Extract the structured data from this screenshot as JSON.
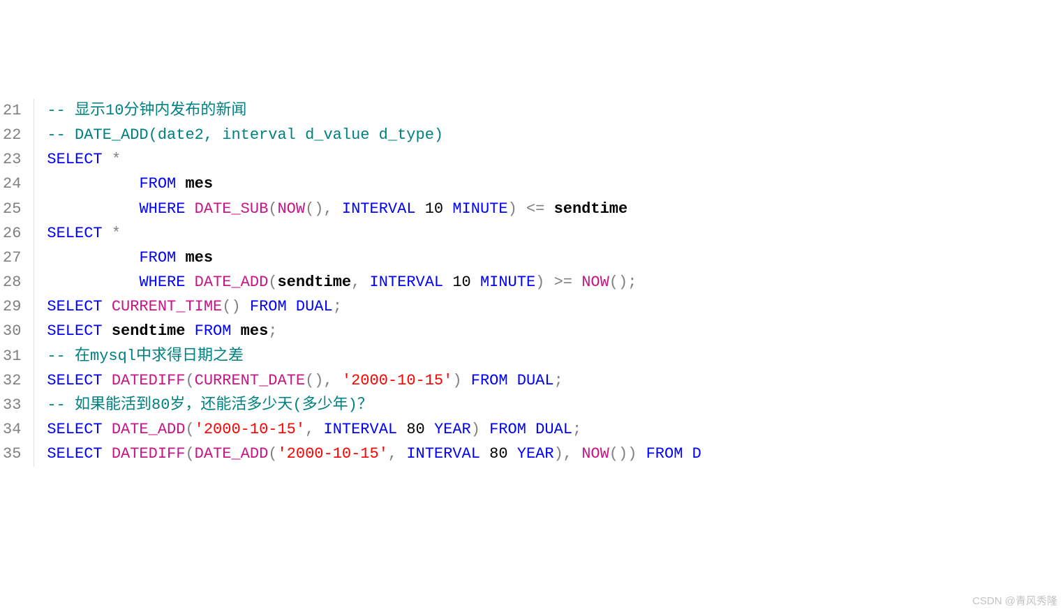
{
  "watermark": "CSDN @青风秀隆",
  "lines": [
    {
      "num": "21",
      "tokens": [
        {
          "cls": "kw-teal",
          "t": "-- 显示10分钟内发布的新闻"
        }
      ]
    },
    {
      "num": "22",
      "tokens": [
        {
          "cls": "kw-teal",
          "t": "-- DATE_ADD(date2, interval d_value d_type)"
        }
      ]
    },
    {
      "num": "23",
      "tokens": [
        {
          "cls": "kw-blue",
          "t": "SELECT"
        },
        {
          "cls": "kw-black-nb",
          "t": " "
        },
        {
          "cls": "star",
          "t": "*"
        }
      ]
    },
    {
      "num": "24",
      "tokens": [
        {
          "cls": "kw-black-nb",
          "t": "          "
        },
        {
          "cls": "kw-blue",
          "t": "FROM"
        },
        {
          "cls": "kw-black-nb",
          "t": " "
        },
        {
          "cls": "kw-black",
          "t": "mes"
        }
      ]
    },
    {
      "num": "25",
      "tokens": [
        {
          "cls": "kw-black-nb",
          "t": "          "
        },
        {
          "cls": "kw-blue",
          "t": "WHERE"
        },
        {
          "cls": "kw-black-nb",
          "t": " "
        },
        {
          "cls": "kw-magenta",
          "t": "DATE_SUB"
        },
        {
          "cls": "op",
          "t": "("
        },
        {
          "cls": "kw-magenta",
          "t": "NOW"
        },
        {
          "cls": "op",
          "t": "(), "
        },
        {
          "cls": "kw-blue",
          "t": "INTERVAL"
        },
        {
          "cls": "kw-black-nb",
          "t": " "
        },
        {
          "cls": "num",
          "t": "10"
        },
        {
          "cls": "kw-black-nb",
          "t": " "
        },
        {
          "cls": "kw-blue",
          "t": "MINUTE"
        },
        {
          "cls": "op",
          "t": ") "
        },
        {
          "cls": "op",
          "t": "<="
        },
        {
          "cls": "kw-black-nb",
          "t": " "
        },
        {
          "cls": "kw-black",
          "t": "sendtime"
        }
      ]
    },
    {
      "num": "26",
      "tokens": [
        {
          "cls": "kw-blue",
          "t": "SELECT"
        },
        {
          "cls": "kw-black-nb",
          "t": " "
        },
        {
          "cls": "star",
          "t": "*"
        }
      ]
    },
    {
      "num": "27",
      "tokens": [
        {
          "cls": "kw-black-nb",
          "t": "          "
        },
        {
          "cls": "kw-blue",
          "t": "FROM"
        },
        {
          "cls": "kw-black-nb",
          "t": " "
        },
        {
          "cls": "kw-black",
          "t": "mes"
        }
      ]
    },
    {
      "num": "28",
      "tokens": [
        {
          "cls": "kw-black-nb",
          "t": "          "
        },
        {
          "cls": "kw-blue",
          "t": "WHERE"
        },
        {
          "cls": "kw-black-nb",
          "t": " "
        },
        {
          "cls": "kw-magenta",
          "t": "DATE_ADD"
        },
        {
          "cls": "op",
          "t": "("
        },
        {
          "cls": "kw-black",
          "t": "sendtime"
        },
        {
          "cls": "op",
          "t": ", "
        },
        {
          "cls": "kw-blue",
          "t": "INTERVAL"
        },
        {
          "cls": "kw-black-nb",
          "t": " "
        },
        {
          "cls": "num",
          "t": "10"
        },
        {
          "cls": "kw-black-nb",
          "t": " "
        },
        {
          "cls": "kw-blue",
          "t": "MINUTE"
        },
        {
          "cls": "op",
          "t": ") "
        },
        {
          "cls": "op",
          "t": ">="
        },
        {
          "cls": "kw-black-nb",
          "t": " "
        },
        {
          "cls": "kw-magenta",
          "t": "NOW"
        },
        {
          "cls": "op",
          "t": "();"
        }
      ]
    },
    {
      "num": "29",
      "tokens": [
        {
          "cls": "kw-blue",
          "t": "SELECT"
        },
        {
          "cls": "kw-black-nb",
          "t": " "
        },
        {
          "cls": "kw-magenta",
          "t": "CURRENT_TIME"
        },
        {
          "cls": "op",
          "t": "() "
        },
        {
          "cls": "kw-blue",
          "t": "FROM"
        },
        {
          "cls": "kw-black-nb",
          "t": " "
        },
        {
          "cls": "kw-blue",
          "t": "DUAL"
        },
        {
          "cls": "op",
          "t": ";"
        }
      ]
    },
    {
      "num": "30",
      "tokens": [
        {
          "cls": "kw-blue",
          "t": "SELECT"
        },
        {
          "cls": "kw-black-nb",
          "t": " "
        },
        {
          "cls": "kw-black",
          "t": "sendtime"
        },
        {
          "cls": "kw-black-nb",
          "t": " "
        },
        {
          "cls": "kw-blue",
          "t": "FROM"
        },
        {
          "cls": "kw-black-nb",
          "t": " "
        },
        {
          "cls": "kw-black",
          "t": "mes"
        },
        {
          "cls": "op",
          "t": ";"
        }
      ]
    },
    {
      "num": "31",
      "tokens": [
        {
          "cls": "kw-teal",
          "t": "-- 在mysql中求得日期之差"
        }
      ]
    },
    {
      "num": "32",
      "tokens": [
        {
          "cls": "kw-blue",
          "t": "SELECT"
        },
        {
          "cls": "kw-black-nb",
          "t": " "
        },
        {
          "cls": "kw-magenta",
          "t": "DATEDIFF"
        },
        {
          "cls": "op",
          "t": "("
        },
        {
          "cls": "kw-magenta",
          "t": "CURRENT_DATE"
        },
        {
          "cls": "op",
          "t": "(), "
        },
        {
          "cls": "kw-red",
          "t": "'2000-10-15'"
        },
        {
          "cls": "op",
          "t": ") "
        },
        {
          "cls": "kw-blue",
          "t": "FROM"
        },
        {
          "cls": "kw-black-nb",
          "t": " "
        },
        {
          "cls": "kw-blue",
          "t": "DUAL"
        },
        {
          "cls": "op",
          "t": ";"
        }
      ]
    },
    {
      "num": "33",
      "tokens": [
        {
          "cls": "kw-teal",
          "t": "-- 如果能活到80岁，还能活多少天(多少年)？"
        }
      ]
    },
    {
      "num": "34",
      "tokens": [
        {
          "cls": "kw-blue",
          "t": "SELECT"
        },
        {
          "cls": "kw-black-nb",
          "t": " "
        },
        {
          "cls": "kw-magenta",
          "t": "DATE_ADD"
        },
        {
          "cls": "op",
          "t": "("
        },
        {
          "cls": "kw-red",
          "t": "'2000-10-15'"
        },
        {
          "cls": "op",
          "t": ", "
        },
        {
          "cls": "kw-blue",
          "t": "INTERVAL"
        },
        {
          "cls": "kw-black-nb",
          "t": " "
        },
        {
          "cls": "num",
          "t": "80"
        },
        {
          "cls": "kw-black-nb",
          "t": " "
        },
        {
          "cls": "kw-blue",
          "t": "YEAR"
        },
        {
          "cls": "op",
          "t": ") "
        },
        {
          "cls": "kw-blue",
          "t": "FROM"
        },
        {
          "cls": "kw-black-nb",
          "t": " "
        },
        {
          "cls": "kw-blue",
          "t": "DUAL"
        },
        {
          "cls": "op",
          "t": ";"
        }
      ]
    },
    {
      "num": "35",
      "tokens": [
        {
          "cls": "kw-blue",
          "t": "SELECT"
        },
        {
          "cls": "kw-black-nb",
          "t": " "
        },
        {
          "cls": "kw-magenta",
          "t": "DATEDIFF"
        },
        {
          "cls": "op",
          "t": "("
        },
        {
          "cls": "kw-magenta",
          "t": "DATE_ADD"
        },
        {
          "cls": "op",
          "t": "("
        },
        {
          "cls": "kw-red",
          "t": "'2000-10-15'"
        },
        {
          "cls": "op",
          "t": ", "
        },
        {
          "cls": "kw-blue",
          "t": "INTERVAL"
        },
        {
          "cls": "kw-black-nb",
          "t": " "
        },
        {
          "cls": "num",
          "t": "80"
        },
        {
          "cls": "kw-black-nb",
          "t": " "
        },
        {
          "cls": "kw-blue",
          "t": "YEAR"
        },
        {
          "cls": "op",
          "t": "), "
        },
        {
          "cls": "kw-magenta",
          "t": "NOW"
        },
        {
          "cls": "op",
          "t": "()) "
        },
        {
          "cls": "kw-blue",
          "t": "FROM"
        },
        {
          "cls": "kw-black-nb",
          "t": " "
        },
        {
          "cls": "kw-blue",
          "t": "D"
        }
      ]
    }
  ]
}
